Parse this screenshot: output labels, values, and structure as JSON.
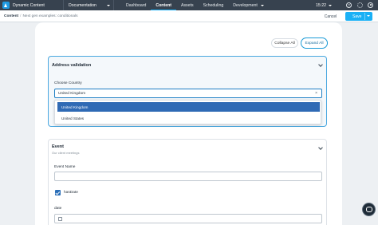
{
  "app": {
    "name": "Dynamic Content",
    "hub": "Documentation"
  },
  "nav": {
    "items": [
      {
        "label": "Dashboard"
      },
      {
        "label": "Content"
      },
      {
        "label": "Assets"
      },
      {
        "label": "Scheduling"
      },
      {
        "label": "Development"
      }
    ]
  },
  "clock": {
    "time": "15:22"
  },
  "breadcrumb": {
    "root": "Content",
    "separator": "/",
    "current": "Next gen examples: conditionals"
  },
  "actions": {
    "cancel": "Cancel",
    "save": "Save"
  },
  "toolbar": {
    "collapse_all": "Collapse All",
    "expand_all": "Expand All"
  },
  "address": {
    "title": "Address validation",
    "country_label": "Choose Country",
    "country_value": "United Kingdom",
    "clear_glyph": "×",
    "options": [
      {
        "label": "United Kingdom",
        "selected": true
      },
      {
        "label": "United States",
        "selected": false
      }
    ]
  },
  "event": {
    "title": "Event",
    "subtitle": "Our client meetings",
    "name_label": "Event Name",
    "name_value": "",
    "hasdate_label": "hasDate",
    "hasdate_checked": true,
    "date_label": "date",
    "date_value": ""
  },
  "colors": {
    "topbar": "#37424f",
    "accent": "#1ab0f5",
    "selected": "#2f6ab5"
  },
  "icons": [
    "app-logo-icon",
    "help-icon",
    "settings-icon",
    "user-icon",
    "chevron-down-icon",
    "clear-icon",
    "calendar-icon",
    "checkmark-icon",
    "chat-icon"
  ]
}
